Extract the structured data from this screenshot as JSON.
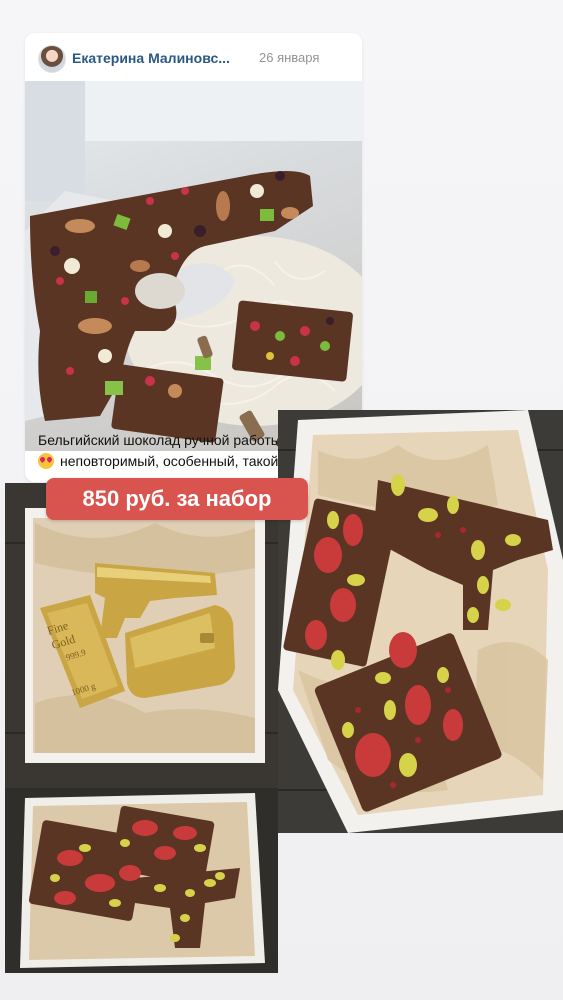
{
  "post": {
    "author": "Екатерина Малиновс...",
    "date": "26 января",
    "text_line1": "Бельгийский шоколад ручной работы",
    "text_line2": "неповторимый, особенный, такой,...",
    "emoji_icon": "heart-eyes-emoji-icon"
  },
  "price_badge": "850 руб. за набор",
  "photos": {
    "gold_set": {
      "bar_text_line1": "Fine",
      "bar_text_line2": "Gold",
      "bar_text_line3": "999.9",
      "bar_text_line4": "1000 g"
    }
  },
  "colors": {
    "link_blue": "#2a5885",
    "badge_red": "#d9534f",
    "chocolate": "#5a3524"
  }
}
